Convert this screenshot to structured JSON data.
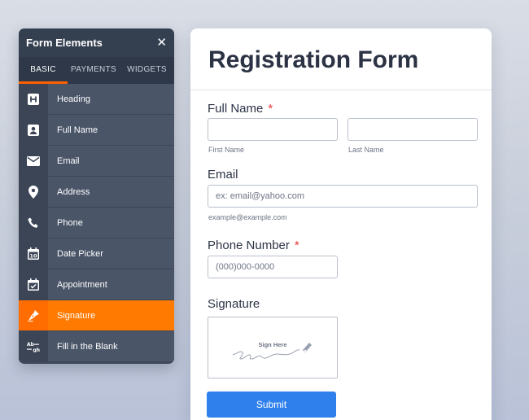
{
  "panel": {
    "title": "Form Elements",
    "close_symbol": "✕",
    "tabs": [
      "BASIC",
      "PAYMENTS",
      "WIDGETS"
    ],
    "active_tab": "BASIC",
    "accent_color": "#ff6100",
    "items": [
      {
        "label": "Heading",
        "icon": "heading-icon"
      },
      {
        "label": "Full Name",
        "icon": "id-card-icon"
      },
      {
        "label": "Email",
        "icon": "envelope-icon"
      },
      {
        "label": "Address",
        "icon": "map-pin-icon"
      },
      {
        "label": "Phone",
        "icon": "phone-icon"
      },
      {
        "label": "Date Picker",
        "icon": "calendar-icon"
      },
      {
        "label": "Appointment",
        "icon": "calendar-check-icon"
      },
      {
        "label": "Signature",
        "icon": "pen-nib-icon",
        "active": true
      },
      {
        "label": "Fill in the Blank",
        "icon": "fill-blank-icon"
      }
    ]
  },
  "form": {
    "title": "Registration Form",
    "full_name": {
      "label": "Full Name",
      "required_mark": "*",
      "first_sublabel": "First Name",
      "last_sublabel": "Last Name"
    },
    "email": {
      "label": "Email",
      "placeholder": "ex: email@yahoo.com",
      "sublabel": "example@example.com"
    },
    "phone": {
      "label": "Phone Number",
      "required_mark": "*",
      "placeholder": "(000)000-0000"
    },
    "signature": {
      "label": "Signature",
      "pad_text": "Sign Here"
    },
    "submit_label": "Submit",
    "submit_color": "#2f80ed"
  }
}
